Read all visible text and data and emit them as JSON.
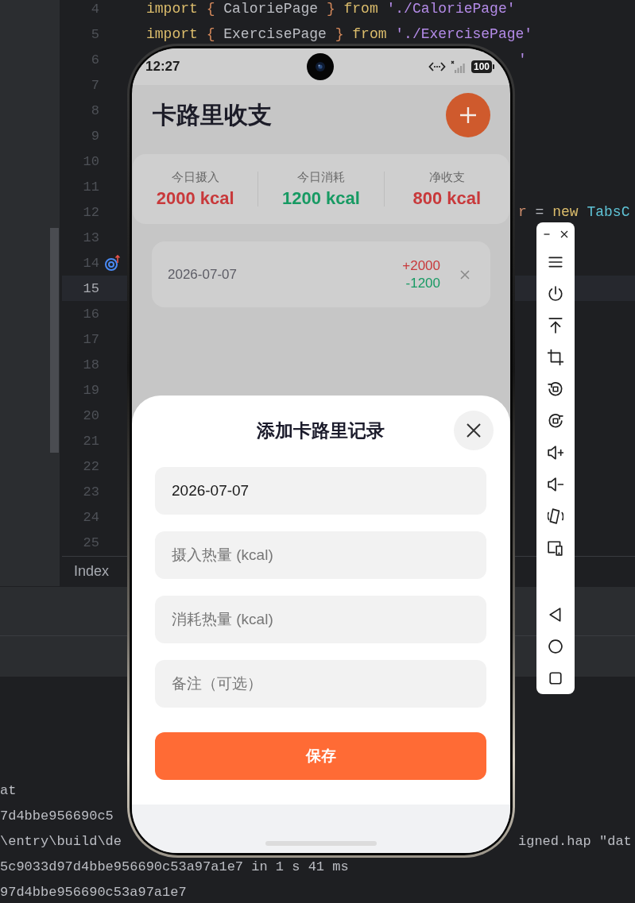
{
  "ide": {
    "lines": [
      {
        "number": "4",
        "current": false,
        "marker": false,
        "code": [
          {
            "text": "import ",
            "kind": "keyword"
          },
          {
            "text": "{",
            "kind": "brace"
          },
          {
            "text": " CaloriePage ",
            "kind": "plain"
          },
          {
            "text": "}",
            "kind": "brace"
          },
          {
            "text": " from ",
            "kind": "keyword"
          },
          {
            "text": "'./CaloriePage'",
            "kind": "string"
          }
        ]
      },
      {
        "number": "5",
        "current": false,
        "marker": false,
        "code": [
          {
            "text": "import ",
            "kind": "keyword"
          },
          {
            "text": "{",
            "kind": "brace"
          },
          {
            "text": " ExercisePage ",
            "kind": "plain"
          },
          {
            "text": "}",
            "kind": "brace"
          },
          {
            "text": " from ",
            "kind": "keyword"
          },
          {
            "text": "'./ExercisePage'",
            "kind": "string"
          }
        ]
      },
      {
        "number": "6",
        "current": false,
        "marker": false,
        "tail": [
          {
            "text": "'",
            "kind": "string"
          }
        ]
      },
      {
        "number": "7",
        "current": false,
        "marker": false
      },
      {
        "number": "8",
        "current": false,
        "marker": false
      },
      {
        "number": "9",
        "current": false,
        "marker": false
      },
      {
        "number": "10",
        "current": false,
        "marker": false
      },
      {
        "number": "11",
        "current": false,
        "marker": false
      },
      {
        "number": "12",
        "current": false,
        "marker": false,
        "tail": [
          {
            "text": "r",
            "kind": "variable"
          },
          {
            "text": " = ",
            "kind": "plain"
          },
          {
            "text": "new ",
            "kind": "keyword"
          },
          {
            "text": "TabsC",
            "kind": "type"
          }
        ]
      },
      {
        "number": "13",
        "current": false,
        "marker": false
      },
      {
        "number": "14",
        "current": false,
        "marker": true
      },
      {
        "number": "15",
        "current": true,
        "marker": false
      },
      {
        "number": "16",
        "current": false,
        "marker": false
      },
      {
        "number": "17",
        "current": false,
        "marker": false
      },
      {
        "number": "18",
        "current": false,
        "marker": false
      },
      {
        "number": "19",
        "current": false,
        "marker": false
      },
      {
        "number": "20",
        "current": false,
        "marker": false
      },
      {
        "number": "21",
        "current": false,
        "marker": false
      },
      {
        "number": "22",
        "current": false,
        "marker": false
      },
      {
        "number": "23",
        "current": false,
        "marker": false
      },
      {
        "number": "24",
        "current": false,
        "marker": false
      },
      {
        "number": "25",
        "current": false,
        "marker": false
      }
    ],
    "tab": {
      "label": "Index"
    },
    "terminal": [
      {
        "text": "at"
      },
      {
        "text": "7d4bbe956690c5"
      },
      {
        "text": "\\entry\\build\\de",
        "tail": "igned.hap \"dat"
      },
      {
        "text": "5c9033d97d4bbe956690c53a97a1e7 in 1 s 41 ms"
      },
      {
        "text": "97d4bbe956690c53a97a1e7"
      }
    ]
  },
  "phone": {
    "status_bar": {
      "time": "12:27",
      "battery": "100"
    },
    "app": {
      "title": "卡路里收支",
      "summary": [
        {
          "label": "今日摄入",
          "value": "2000 kcal",
          "color": "#c8393b"
        },
        {
          "label": "今日消耗",
          "value": "1200 kcal",
          "color": "#179a63"
        },
        {
          "label": "净收支",
          "value": "800 kcal",
          "color": "#c8393b"
        }
      ],
      "records": [
        {
          "date": "2026-07-07",
          "intake": "+2000",
          "burn": "-1200"
        }
      ]
    },
    "sheet": {
      "title": "添加卡路里记录",
      "fields": [
        {
          "value": "2026-07-07"
        },
        {
          "placeholder": "摄入热量 (kcal)"
        },
        {
          "placeholder": "消耗热量 (kcal)"
        },
        {
          "placeholder": "备注（可选）"
        }
      ],
      "save_button": "保存"
    }
  }
}
